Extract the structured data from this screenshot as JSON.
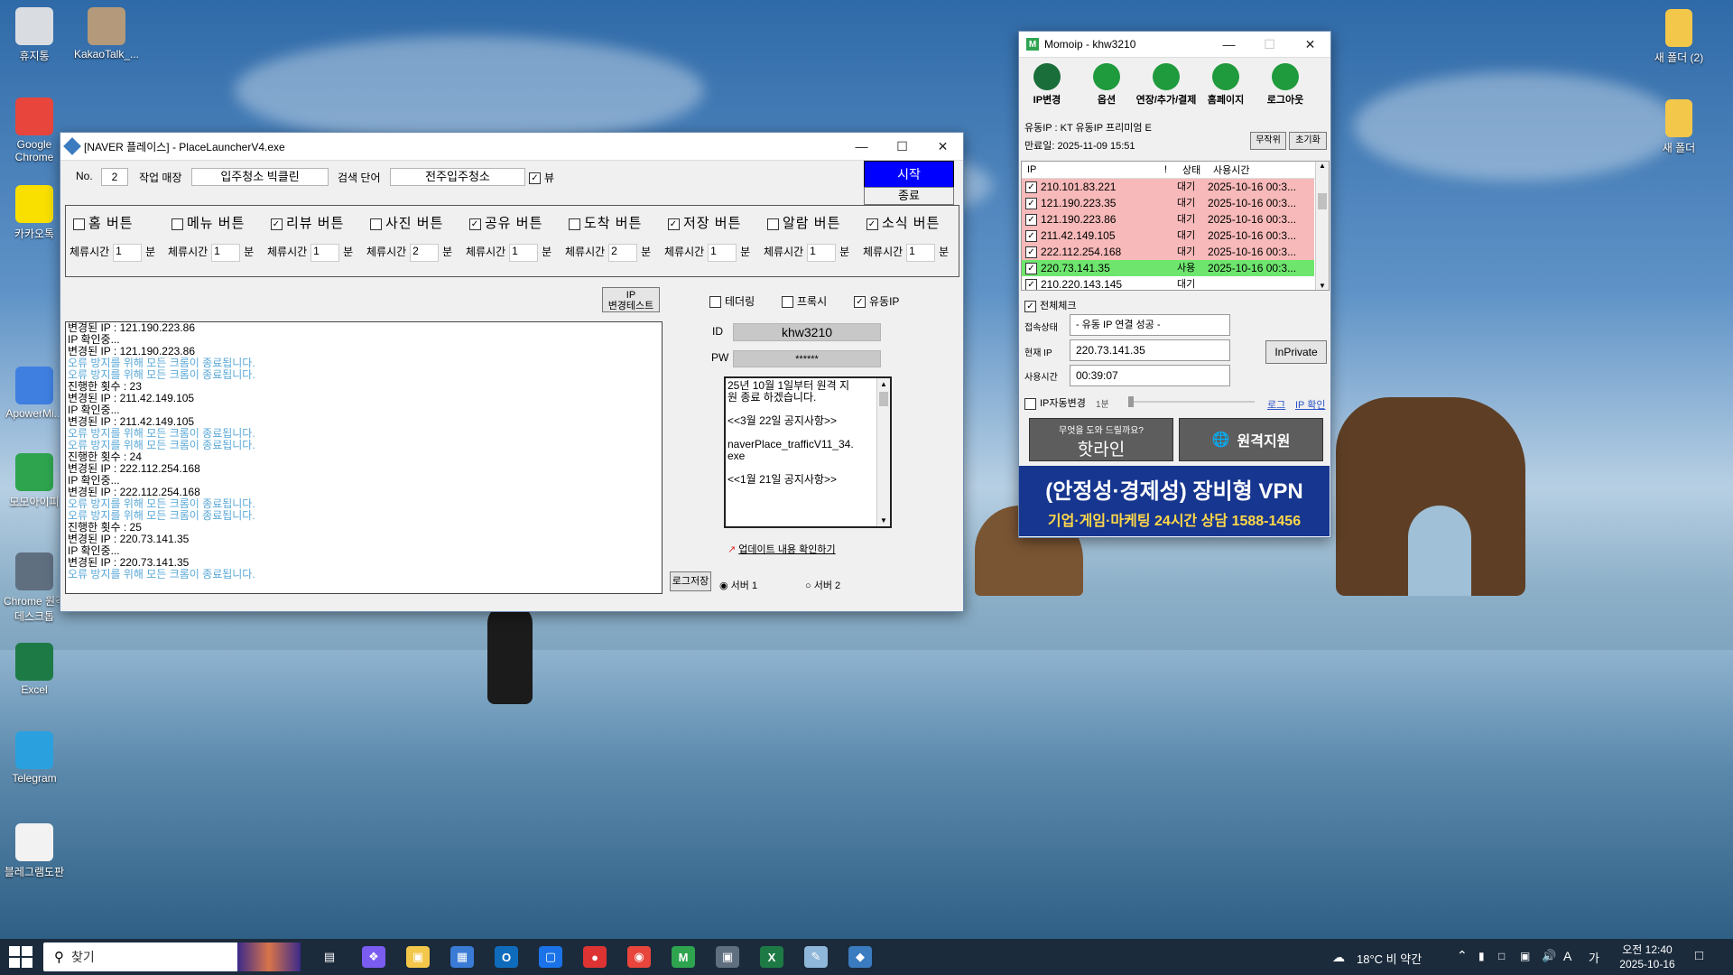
{
  "desktop": {
    "icons_left": [
      {
        "label": "휴지통",
        "icon": "recycle-bin-icon",
        "color": "#d9dde2"
      },
      {
        "label": "KakaoTalk_...",
        "icon": "kakaotalk-file-icon",
        "color": "#b49a7a"
      },
      {
        "label": "Google Chrome",
        "icon": "chrome-icon",
        "color": "#e8453c"
      },
      {
        "label": "카카오톡",
        "icon": "kakaotalk-icon",
        "color": "#f9e000"
      },
      {
        "label": "ApowerMi...",
        "icon": "apowermirror-icon",
        "color": "#3f7fe0"
      },
      {
        "label": "모모아이피",
        "icon": "momoip-icon",
        "color": "#2ea44f"
      },
      {
        "label": "Chrome 원격 데스크톱",
        "icon": "chrome-remote-desktop-icon",
        "color": "#5f6f80"
      },
      {
        "label": "Excel",
        "icon": "excel-icon",
        "color": "#1d7a45"
      },
      {
        "label": "Telegram",
        "icon": "telegram-icon",
        "color": "#2aa1de"
      },
      {
        "label": "블레그램도판",
        "icon": "text-file-icon",
        "color": "#f2f2f2"
      }
    ],
    "icons_right": [
      {
        "label": "새 폴더 (2)",
        "icon": "folder-icon",
        "color": "#f3c74a"
      },
      {
        "label": "새 폴더",
        "icon": "folder-icon",
        "color": "#f3c74a"
      }
    ]
  },
  "launcher": {
    "title": "[NAVER 플레이스] - PlaceLauncherV4.exe",
    "no_label": "No.",
    "no_value": "2",
    "store_label": "작업 매장",
    "store_value": "입주청소 빅클린",
    "keyword_label": "검색 단어",
    "keyword_value": "전주입주청소",
    "view_label": "뷰",
    "start_label": "시작",
    "stop_label": "종료",
    "stay_label": "체류시간",
    "minute_label": "분",
    "buttons": [
      {
        "label": "홈 버튼",
        "checked": false,
        "stay": "1"
      },
      {
        "label": "메뉴 버튼",
        "checked": false,
        "stay": "1"
      },
      {
        "label": "리뷰 버튼",
        "checked": true,
        "stay": "1"
      },
      {
        "label": "사진 버튼",
        "checked": false,
        "stay": "2"
      },
      {
        "label": "공유 버튼",
        "checked": true,
        "stay": "1"
      },
      {
        "label": "도착 버튼",
        "checked": false,
        "stay": "2"
      },
      {
        "label": "저장 버튼",
        "checked": true,
        "stay": "1"
      },
      {
        "label": "알람 버튼",
        "checked": false,
        "stay": "1"
      },
      {
        "label": "소식 버튼",
        "checked": true,
        "stay": "1"
      }
    ],
    "ip_test_label_1": "IP",
    "ip_test_label_2": "변경테스트",
    "tethering_label": "테더링",
    "proxy_label": "프록시",
    "paid_ip_label": "유동IP",
    "id_label": "ID",
    "id_value": "khw3210",
    "pw_label": "PW",
    "pw_value": "******",
    "log_lines": [
      {
        "text": "변경된 IP : 121.190.223.86",
        "blue": false
      },
      {
        "text": "IP 확인중...",
        "blue": false
      },
      {
        "text": "변경된 IP : 121.190.223.86",
        "blue": false
      },
      {
        "text": "오류 방지를 위해 모든 크롬이 종료됩니다.",
        "blue": true
      },
      {
        "text": "오류 방지를 위해 모든 크롬이 종료됩니다.",
        "blue": true
      },
      {
        "text": "진행한 횟수 : 23",
        "blue": false
      },
      {
        "text": "변경된 IP : 211.42.149.105",
        "blue": false
      },
      {
        "text": "IP 확인중...",
        "blue": false
      },
      {
        "text": "변경된 IP : 211.42.149.105",
        "blue": false
      },
      {
        "text": "오류 방지를 위해 모든 크롬이 종료됩니다.",
        "blue": true
      },
      {
        "text": "오류 방지를 위해 모든 크롬이 종료됩니다.",
        "blue": true
      },
      {
        "text": "진행한 횟수 : 24",
        "blue": false
      },
      {
        "text": "변경된 IP : 222.112.254.168",
        "blue": false
      },
      {
        "text": "IP 확인중...",
        "blue": false
      },
      {
        "text": "변경된 IP : 222.112.254.168",
        "blue": false
      },
      {
        "text": "오류 방지를 위해 모든 크롬이 종료됩니다.",
        "blue": true
      },
      {
        "text": "오류 방지를 위해 모든 크롬이 종료됩니다.",
        "blue": true
      },
      {
        "text": "진행한 횟수 : 25",
        "blue": false
      },
      {
        "text": "변경된 IP : 220.73.141.35",
        "blue": false
      },
      {
        "text": "IP 확인중...",
        "blue": false
      },
      {
        "text": "변경된 IP : 220.73.141.35",
        "blue": false
      },
      {
        "text": "오류 방지를 위해 모든 크롬이 종료됩니다.",
        "blue": true
      }
    ],
    "notice_lines": [
      "25년 10월 1일부터 원격 지",
      "원 종료 하겠습니다.",
      "",
      "<<3월 22일 공지사항>>",
      "",
      "naverPlace_trafficV11_34.",
      "exe",
      "",
      "<<1월 21일 공지사항>>"
    ],
    "update_link": "업데이트 내용 확인하기",
    "log_save_label": "로그저장",
    "server1_label": "서버 1",
    "server2_label": "서버 2"
  },
  "momoip": {
    "title": "Momoip - khw3210",
    "tools": [
      {
        "label": "IP변경",
        "icon": "ip-change-icon",
        "color": "#1a6e3a"
      },
      {
        "label": "옵션",
        "icon": "gear-icon",
        "color": "#1f9a3c"
      },
      {
        "label": "연장/추가/결제",
        "icon": "payment-icon",
        "color": "#1f9a3c"
      },
      {
        "label": "홈페이지",
        "icon": "home-icon",
        "color": "#1f9a3c"
      },
      {
        "label": "로그아웃",
        "icon": "lock-icon",
        "color": "#1f9a3c"
      }
    ],
    "plan": "유동IP : KT 유동IP 프리미엄 E",
    "expire": "만료일: 2025-11-09 15:51",
    "random_label": "무작위",
    "reset_label": "초기화",
    "col_ip": "IP",
    "col_excl": "!",
    "col_status": "상태",
    "col_time": "사용시간",
    "rows": [
      {
        "ip": "210.101.83.221",
        "status": "대기",
        "time": "2025-10-16 00:3...",
        "color": "#f7b9b9"
      },
      {
        "ip": "121.190.223.35",
        "status": "대기",
        "time": "2025-10-16 00:3...",
        "color": "#f7b9b9"
      },
      {
        "ip": "121.190.223.86",
        "status": "대기",
        "time": "2025-10-16 00:3...",
        "color": "#f7b9b9"
      },
      {
        "ip": "211.42.149.105",
        "status": "대기",
        "time": "2025-10-16 00:3...",
        "color": "#f7b9b9"
      },
      {
        "ip": "222.112.254.168",
        "status": "대기",
        "time": "2025-10-16 00:3...",
        "color": "#f7b9b9"
      },
      {
        "ip": "220.73.141.35",
        "status": "사용",
        "time": "2025-10-16 00:3...",
        "color": "#6ee66e"
      },
      {
        "ip": "210.220.143.145",
        "status": "대기",
        "time": "",
        "color": "#ffffff"
      }
    ],
    "check_all": "전체체크",
    "conn_label": "접속상태",
    "conn_value": "- 유동 IP 연결 성공 -",
    "current_ip_label": "현재 IP",
    "current_ip_value": "220.73.141.35",
    "inprivate_label": "InPrivate",
    "usage_label": "사용시간",
    "usage_value": "00:39:07",
    "auto_change_label": "IP자동변경",
    "auto_change_interval": "1분",
    "log_link": "로그",
    "ip_check_link": "IP 확인",
    "hotline_sub": "무엇을 도와 드릴까요?",
    "hotline_label": "핫라인",
    "remote_label": "원격지원",
    "ad_line1": "(안정성·경제성) 장비형 VPN",
    "ad_line2": "기업·게임·마케팅 24시간 상담 1588-1456"
  },
  "taskbar": {
    "search_placeholder": "찾기",
    "weather": "18°C  비 약간",
    "ime": "A",
    "lang": "가",
    "time": "오전 12:40",
    "date": "2025-10-16"
  }
}
